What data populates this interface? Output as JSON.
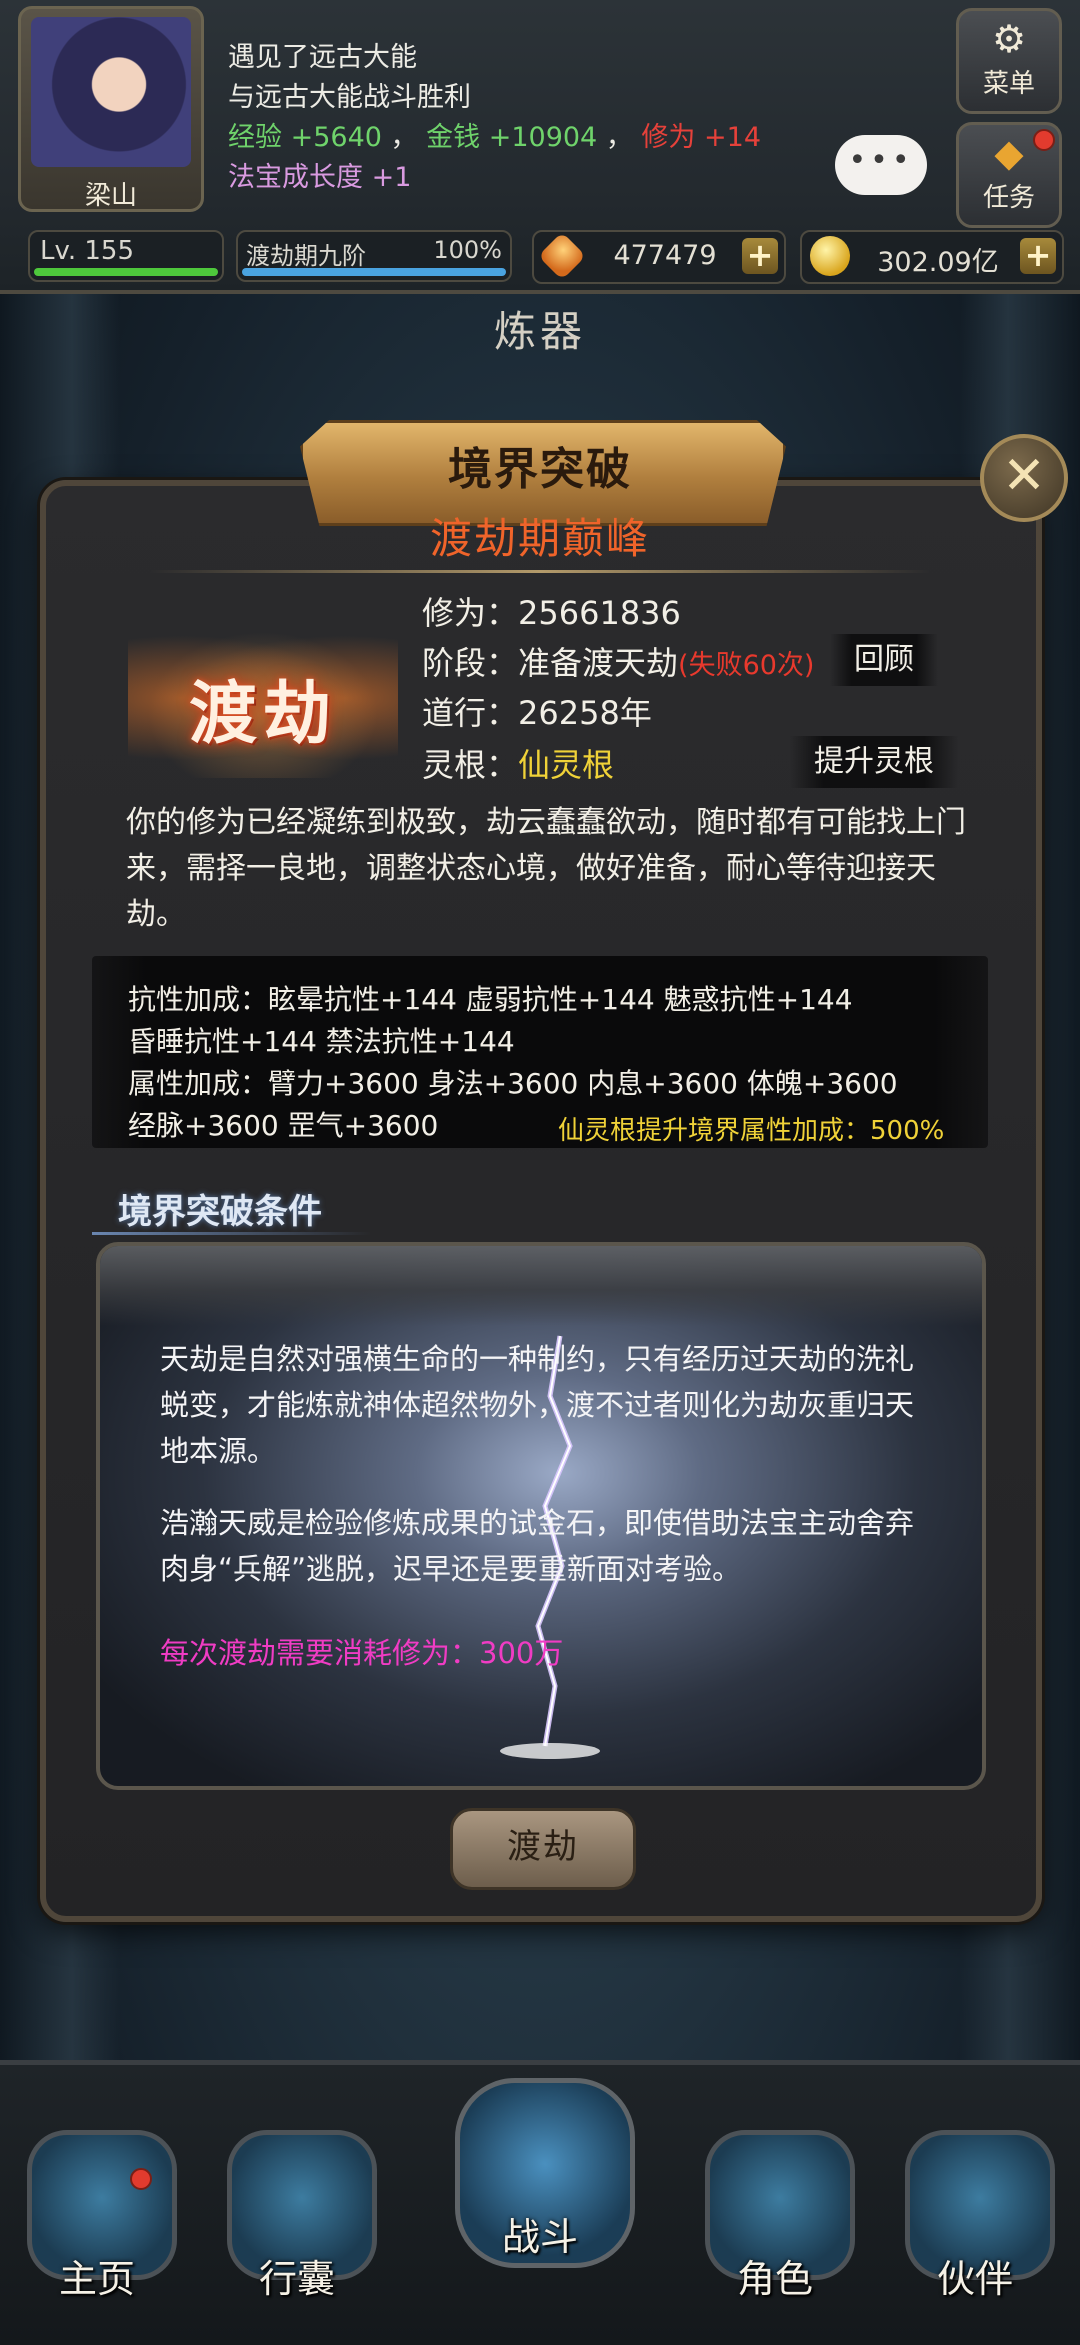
{
  "hud": {
    "player_name": "梁山",
    "log": {
      "line1": "遇见了远古大能",
      "line2": "与远古大能战斗胜利",
      "exp_label": "经验",
      "exp_value": "+5640",
      "sep1": "，",
      "money_label": "金钱",
      "money_value": "+10904",
      "sep2": "，",
      "cult_label": "修为",
      "cult_value": "+14",
      "treasure_label": "法宝成长度",
      "treasure_value": "+1"
    },
    "menu_label": "菜单",
    "task_label": "任务",
    "chat_dots": "•••",
    "level": "Lv. 155",
    "realm": "渡劫期九阶",
    "realm_progress": "100%",
    "gems": "477479",
    "gold": "302.09亿",
    "plus": "+"
  },
  "page_title": "炼器",
  "dialog": {
    "banner": "境界突破",
    "close": "✕",
    "stage_title": "渡劫期巅峰",
    "emblem_text": "渡劫",
    "cultivation_label": "修为：",
    "cultivation_value": "25661836",
    "phase_label": "阶段：",
    "phase_value": "准备渡天劫",
    "phase_fail": "(失败60次)",
    "review_button": "回顾",
    "dao_label": "道行：",
    "dao_value": "26258年",
    "root_label": "灵根：",
    "root_value": "仙灵根",
    "upgrade_root_button": "提升灵根",
    "description": "你的修为已经凝练到极致，劫云蠢蠢欲动，随时都有可能找上门来，需择一良地，调整状态心境，做好准备，耐心等待迎接天劫。",
    "attr_line1": "抗性加成：眩晕抗性+144 虚弱抗性+144 魅惑抗性+144",
    "attr_line2": "昏睡抗性+144 禁法抗性+144",
    "attr_line3": "属性加成：臂力+3600 身法+3600 内息+3600 体魄+3600",
    "attr_line4": "经脉+3600 罡气+3600",
    "attr_bonus": "仙灵根提升境界属性加成：500%",
    "cond_title": "境界突破条件",
    "storm_para1": "天劫是自然对强横生命的一种制约，只有经历过天劫的洗礼蜕变，才能炼就神体超然物外，渡不过者则化为劫灰重归天地本源。",
    "storm_para2": "浩瀚天威是检验修炼成果的试金石，即使借助法宝主动舍弃肉身“兵解”逃脱，迟早还是要重新面对考验。",
    "storm_para3": "每次渡劫需要消耗修为：300万",
    "dujie_button": "渡劫"
  },
  "nav": {
    "home": "主页",
    "bag": "行囊",
    "fight": "战斗",
    "role": "角色",
    "partner": "伙伴"
  },
  "colors": {
    "stage_title": "#f0642a",
    "fail": "#e8392d",
    "root": "#f0d238",
    "cost": "#f03cc4"
  }
}
